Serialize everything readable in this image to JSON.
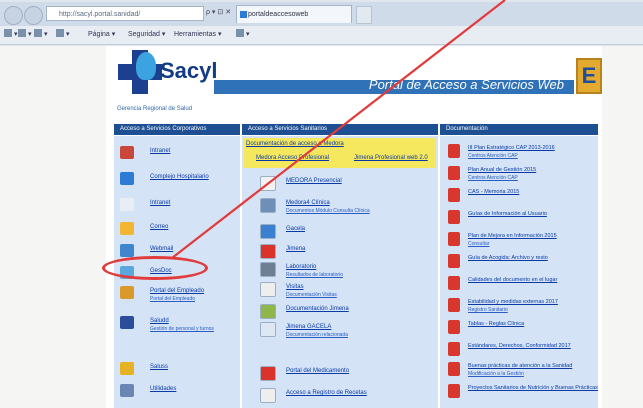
{
  "browser": {
    "address_url": "http://sacyl.portal.sanidad/",
    "address_icons": "ρ ▾ ⊡ ✕",
    "tab_title": "portaldeaccesoweb",
    "commandbar": [
      {
        "label": "▾",
        "icon": "home-icon"
      },
      {
        "label": "▾",
        "icon": "feeds-icon"
      },
      {
        "label": "▾",
        "icon": "mail-icon"
      },
      {
        "label": "▾",
        "icon": "print-icon"
      },
      {
        "label": "Página ▾",
        "icon": ""
      },
      {
        "label": "Seguridad ▾",
        "icon": ""
      },
      {
        "label": "Herramientas ▾",
        "icon": ""
      },
      {
        "label": "▾",
        "icon": "help-icon"
      }
    ]
  },
  "portal": {
    "logo_text": "Sacyl",
    "logo_subtitle": "Gerencia Regional de Salud",
    "header_title": "Portal de Acceso a Servicios Web",
    "badge": "E",
    "columns": [
      {
        "header": "Acceso a Servicios Corporativos"
      },
      {
        "header": "Acceso a Servicios Sanitarios"
      },
      {
        "header": "Documentación"
      }
    ],
    "col1_items": [
      {
        "label": "Intranet",
        "sub": "",
        "icon_color": "#c9473a"
      },
      {
        "label": "Complejo Hospitalario",
        "sub": "",
        "icon_color": "#2e7bd6"
      },
      {
        "label": "Intranet",
        "sub": "",
        "icon_color": "#e8eef6"
      },
      {
        "label": "Correo",
        "sub": "",
        "icon_color": "#f2b632"
      },
      {
        "label": "Webmail",
        "sub": "",
        "icon_color": "#3f86cf"
      },
      {
        "label": "GesDoc",
        "sub": "",
        "icon_color": "#5aa7de"
      },
      {
        "label": "Portal del Empleado",
        "sub": "Portal del Empleado",
        "icon_color": "#d99a2b"
      },
      {
        "label": "Saludd",
        "sub": "Gestión de personal y turnos",
        "icon_color": "#2a4e9c"
      },
      {
        "label": "Saluss",
        "sub": "",
        "icon_color": "#e5b224"
      },
      {
        "label": "Utilidades",
        "sub": "",
        "icon_color": "#6a86b3"
      }
    ],
    "col2_top": {
      "link1": "Documentación de acceso a Medora",
      "link2": "Medora Acceso Profesional",
      "link3": "Jimena Profesional web 2.0"
    },
    "col2_items": [
      {
        "label": "MEDORA Presencial",
        "sub": "",
        "icon_color": "#f2f2f2"
      },
      {
        "label": "Medora4 Clínica",
        "sub": "Documentos Módulo Consulta Clínica",
        "icon_color": "#6d8fb8"
      },
      {
        "label": "Gacela",
        "sub": "",
        "icon_color": "#3a7fd0"
      },
      {
        "label": "Jimena",
        "sub": "",
        "icon_color": "#d9332b"
      },
      {
        "label": "Laboratorio",
        "sub": "Resultados de laboratorio",
        "icon_color": "#6f7f93"
      },
      {
        "label": "Visitas",
        "sub": "Documentación Visitas",
        "icon_color": "#eeeeee"
      },
      {
        "label": "Documentación Jimena",
        "sub": "",
        "icon_color": "#8fb64a"
      },
      {
        "label": "Jimena GACELA",
        "sub": "Documentación relacionada",
        "icon_color": "#dde8f4"
      },
      {
        "label": "Portal del Medicamento",
        "sub": "",
        "icon_color": "#d9332b"
      },
      {
        "label": "Acceso a Registro de Recetas",
        "sub": "",
        "icon_color": "#eeeeee"
      }
    ],
    "col3_items": [
      {
        "label": "III Plan Estratégico CAP 2013-2016",
        "sub": "Centros Atención CAP"
      },
      {
        "label": "Plan Anual de Gestión 2015",
        "sub": "Centros Atención CAP"
      },
      {
        "label": "CAS - Memoria 2015",
        "sub": ""
      },
      {
        "label": "Guías de Información al Usuario",
        "sub": ""
      },
      {
        "label": "Plan de Mejora en Información 2015",
        "sub": "Consultar"
      },
      {
        "label": "Guía de Acogida: Archivo y resto",
        "sub": ""
      },
      {
        "label": "Calidades del documento en el lugar",
        "sub": ""
      },
      {
        "label": "Estabilidad y medidas externas 2017",
        "sub": "Registro Sanitario"
      },
      {
        "label": "Tablas - Reglas Clínica",
        "sub": ""
      },
      {
        "label": "Estándares, Derechos, Conformidad 2017",
        "sub": ""
      },
      {
        "label": "Buenas prácticas de atención a la Sanidad",
        "sub": "Modificación a la Gestión"
      },
      {
        "label": "Proyectos Sanitarios de Nutrición y Buenas Prácticas",
        "sub": ""
      }
    ]
  },
  "colors": {
    "header_blue": "#2f72b8",
    "column_header": "#1e4f93",
    "column_bg": "#d4e3f5",
    "highlight_yellow": "#f6e85e",
    "annotation_red": "#e23b3b"
  }
}
